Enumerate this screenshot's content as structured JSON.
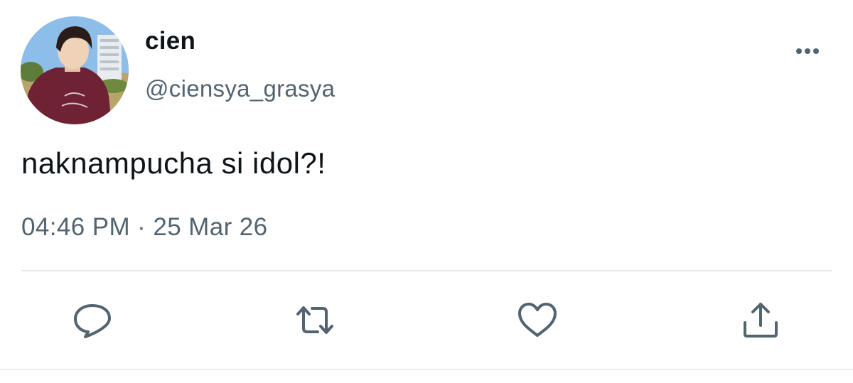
{
  "tweet": {
    "author": {
      "display_name": "cien",
      "handle": "@ciensya_grasya"
    },
    "text": "naknampucha si idol?!",
    "timestamp": {
      "time": "04:46 PM",
      "separator": "·",
      "date": "25 Mar 26"
    },
    "actions": [
      {
        "icon": "reply-icon"
      },
      {
        "icon": "retweet-icon"
      },
      {
        "icon": "like-icon"
      },
      {
        "icon": "share-icon"
      }
    ],
    "more_icon": "more-options-icon"
  },
  "colors": {
    "text_primary": "#0f1419",
    "text_secondary": "#536471",
    "icon": "#536471",
    "divider": "#e6e9ec"
  }
}
